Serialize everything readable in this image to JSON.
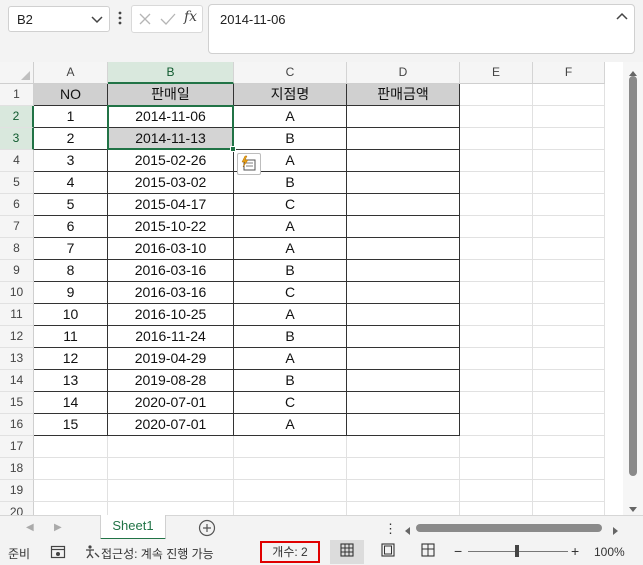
{
  "formula_bar": {
    "name_box": "B2",
    "formula": "2014-11-06"
  },
  "columns": [
    "A",
    "B",
    "C",
    "D",
    "E",
    "F"
  ],
  "rows": [
    "1",
    "2",
    "3",
    "4",
    "5",
    "6",
    "7",
    "8",
    "9",
    "10",
    "11",
    "12",
    "13",
    "14",
    "15",
    "16",
    "17",
    "18",
    "19",
    "20"
  ],
  "table": {
    "headers": [
      "NO",
      "판매일",
      "지점명",
      "판매금액"
    ],
    "rows": [
      [
        "1",
        "2014-11-06",
        "A",
        ""
      ],
      [
        "2",
        "2014-11-13",
        "B",
        ""
      ],
      [
        "3",
        "2015-02-26",
        "A",
        ""
      ],
      [
        "4",
        "2015-03-02",
        "B",
        ""
      ],
      [
        "5",
        "2015-04-17",
        "C",
        ""
      ],
      [
        "6",
        "2015-10-22",
        "A",
        ""
      ],
      [
        "7",
        "2016-03-10",
        "A",
        ""
      ],
      [
        "8",
        "2016-03-16",
        "B",
        ""
      ],
      [
        "9",
        "2016-03-16",
        "C",
        ""
      ],
      [
        "10",
        "2016-10-25",
        "A",
        ""
      ],
      [
        "11",
        "2016-11-24",
        "B",
        ""
      ],
      [
        "12",
        "2019-04-29",
        "A",
        ""
      ],
      [
        "13",
        "2019-08-28",
        "B",
        ""
      ],
      [
        "14",
        "2020-07-01",
        "C",
        ""
      ],
      [
        "15",
        "2020-07-01",
        "A",
        ""
      ]
    ]
  },
  "sheet_tabs": [
    "Sheet1"
  ],
  "status": {
    "ready": "준비",
    "accessibility": "접근성: 계속 진행 가능",
    "count": "개수: 2",
    "zoom": "100%"
  },
  "colors": {
    "accent": "#217346",
    "header_fill": "#d0d0d0",
    "count_highlight": "#e00000"
  }
}
